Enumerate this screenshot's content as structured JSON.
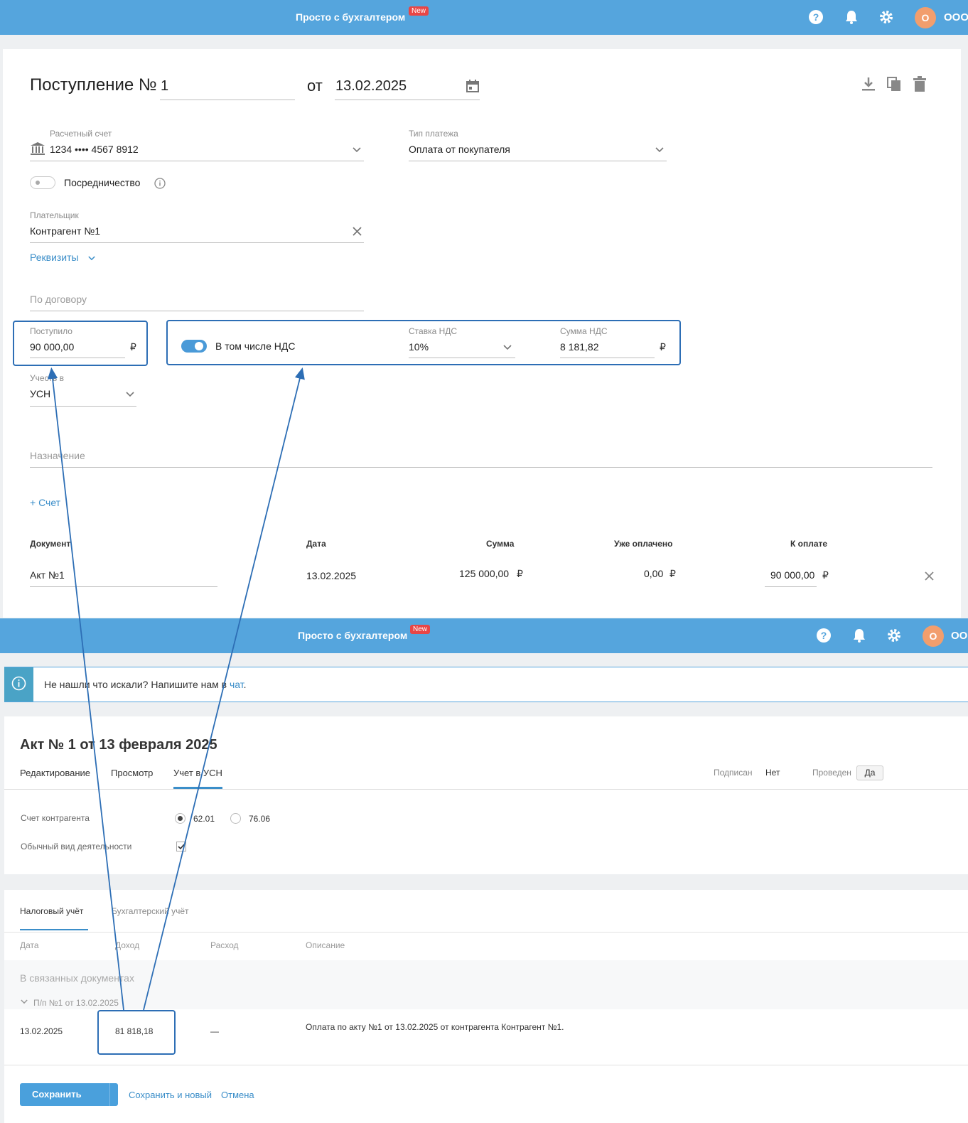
{
  "header": {
    "brand": "Просто с бухгалтером",
    "badge": "New",
    "avatar_letter": "О",
    "org": "ООО",
    "icons": [
      "help-icon",
      "bell-icon",
      "gear-icon"
    ]
  },
  "form": {
    "title_prefix": "Поступление №",
    "number": "1",
    "date_prefix": "от",
    "date": "13.02.2025",
    "account": {
      "label": "Расчетный счет",
      "value": "1234 •••• 4567 8912"
    },
    "payment_type": {
      "label": "Тип платежа",
      "value": "Оплата от покупателя"
    },
    "mediation_label": "Посредничество",
    "payer": {
      "label": "Плательщик",
      "value": "Контрагент №1"
    },
    "details_link": "Реквизиты",
    "contract_placeholder": "По договору",
    "received": {
      "label": "Поступило",
      "value": "90 000,00",
      "currency": "₽"
    },
    "vat_toggle_label": "В том числе НДС",
    "vat_rate": {
      "label": "Ставка НДС",
      "value": "10%"
    },
    "vat_sum": {
      "label": "Сумма НДС",
      "value": "8 181,82",
      "currency": "₽"
    },
    "account_in": {
      "label": "Учесть в",
      "value": "УСН"
    },
    "purpose_placeholder": "Назначение",
    "add_invoice_link": "+ Счет",
    "table": {
      "headers": {
        "document": "Документ",
        "date": "Дата",
        "sum": "Сумма",
        "paid": "Уже оплачено",
        "to_pay": "К оплате"
      },
      "row": {
        "document": "Акт №1",
        "date": "13.02.2025",
        "sum": "125 000,00",
        "paid": "0,00",
        "to_pay": "90 000,00",
        "currency": "₽"
      }
    }
  },
  "info": {
    "text": "Не нашли что искали? Напишите нам в",
    "link": "чат",
    "end": "."
  },
  "act": {
    "title": "Акт № 1 от 13 февраля 2025",
    "tabs": [
      "Редактирование",
      "Просмотр",
      "Учет в УСН"
    ],
    "signed_label": "Подписан",
    "signed_value": "Нет",
    "posted_label": "Проведен",
    "posted_value": "Да",
    "counterparty_account_label": "Счет контрагента",
    "radio_1": "62.01",
    "radio_2": "76.06",
    "activity_label": "Обычный вид деятельности",
    "subtabs": [
      "Налоговый учёт",
      "Бухгалтерский учёт"
    ],
    "cols": {
      "date": "Дата",
      "income": "Доход",
      "expense": "Расход",
      "description": "Описание"
    },
    "related_docs": "В связанных документах",
    "payment_doc": "П/п №1 от 13.02.2025",
    "row": {
      "date": "13.02.2025",
      "income": "81 818,18",
      "expense": "—",
      "description": "Оплата по акту №1 от 13.02.2025 от контрагента Контрагент №1."
    },
    "buttons": {
      "save": "Сохранить",
      "save_new": "Сохранить и новый",
      "cancel": "Отмена"
    }
  }
}
